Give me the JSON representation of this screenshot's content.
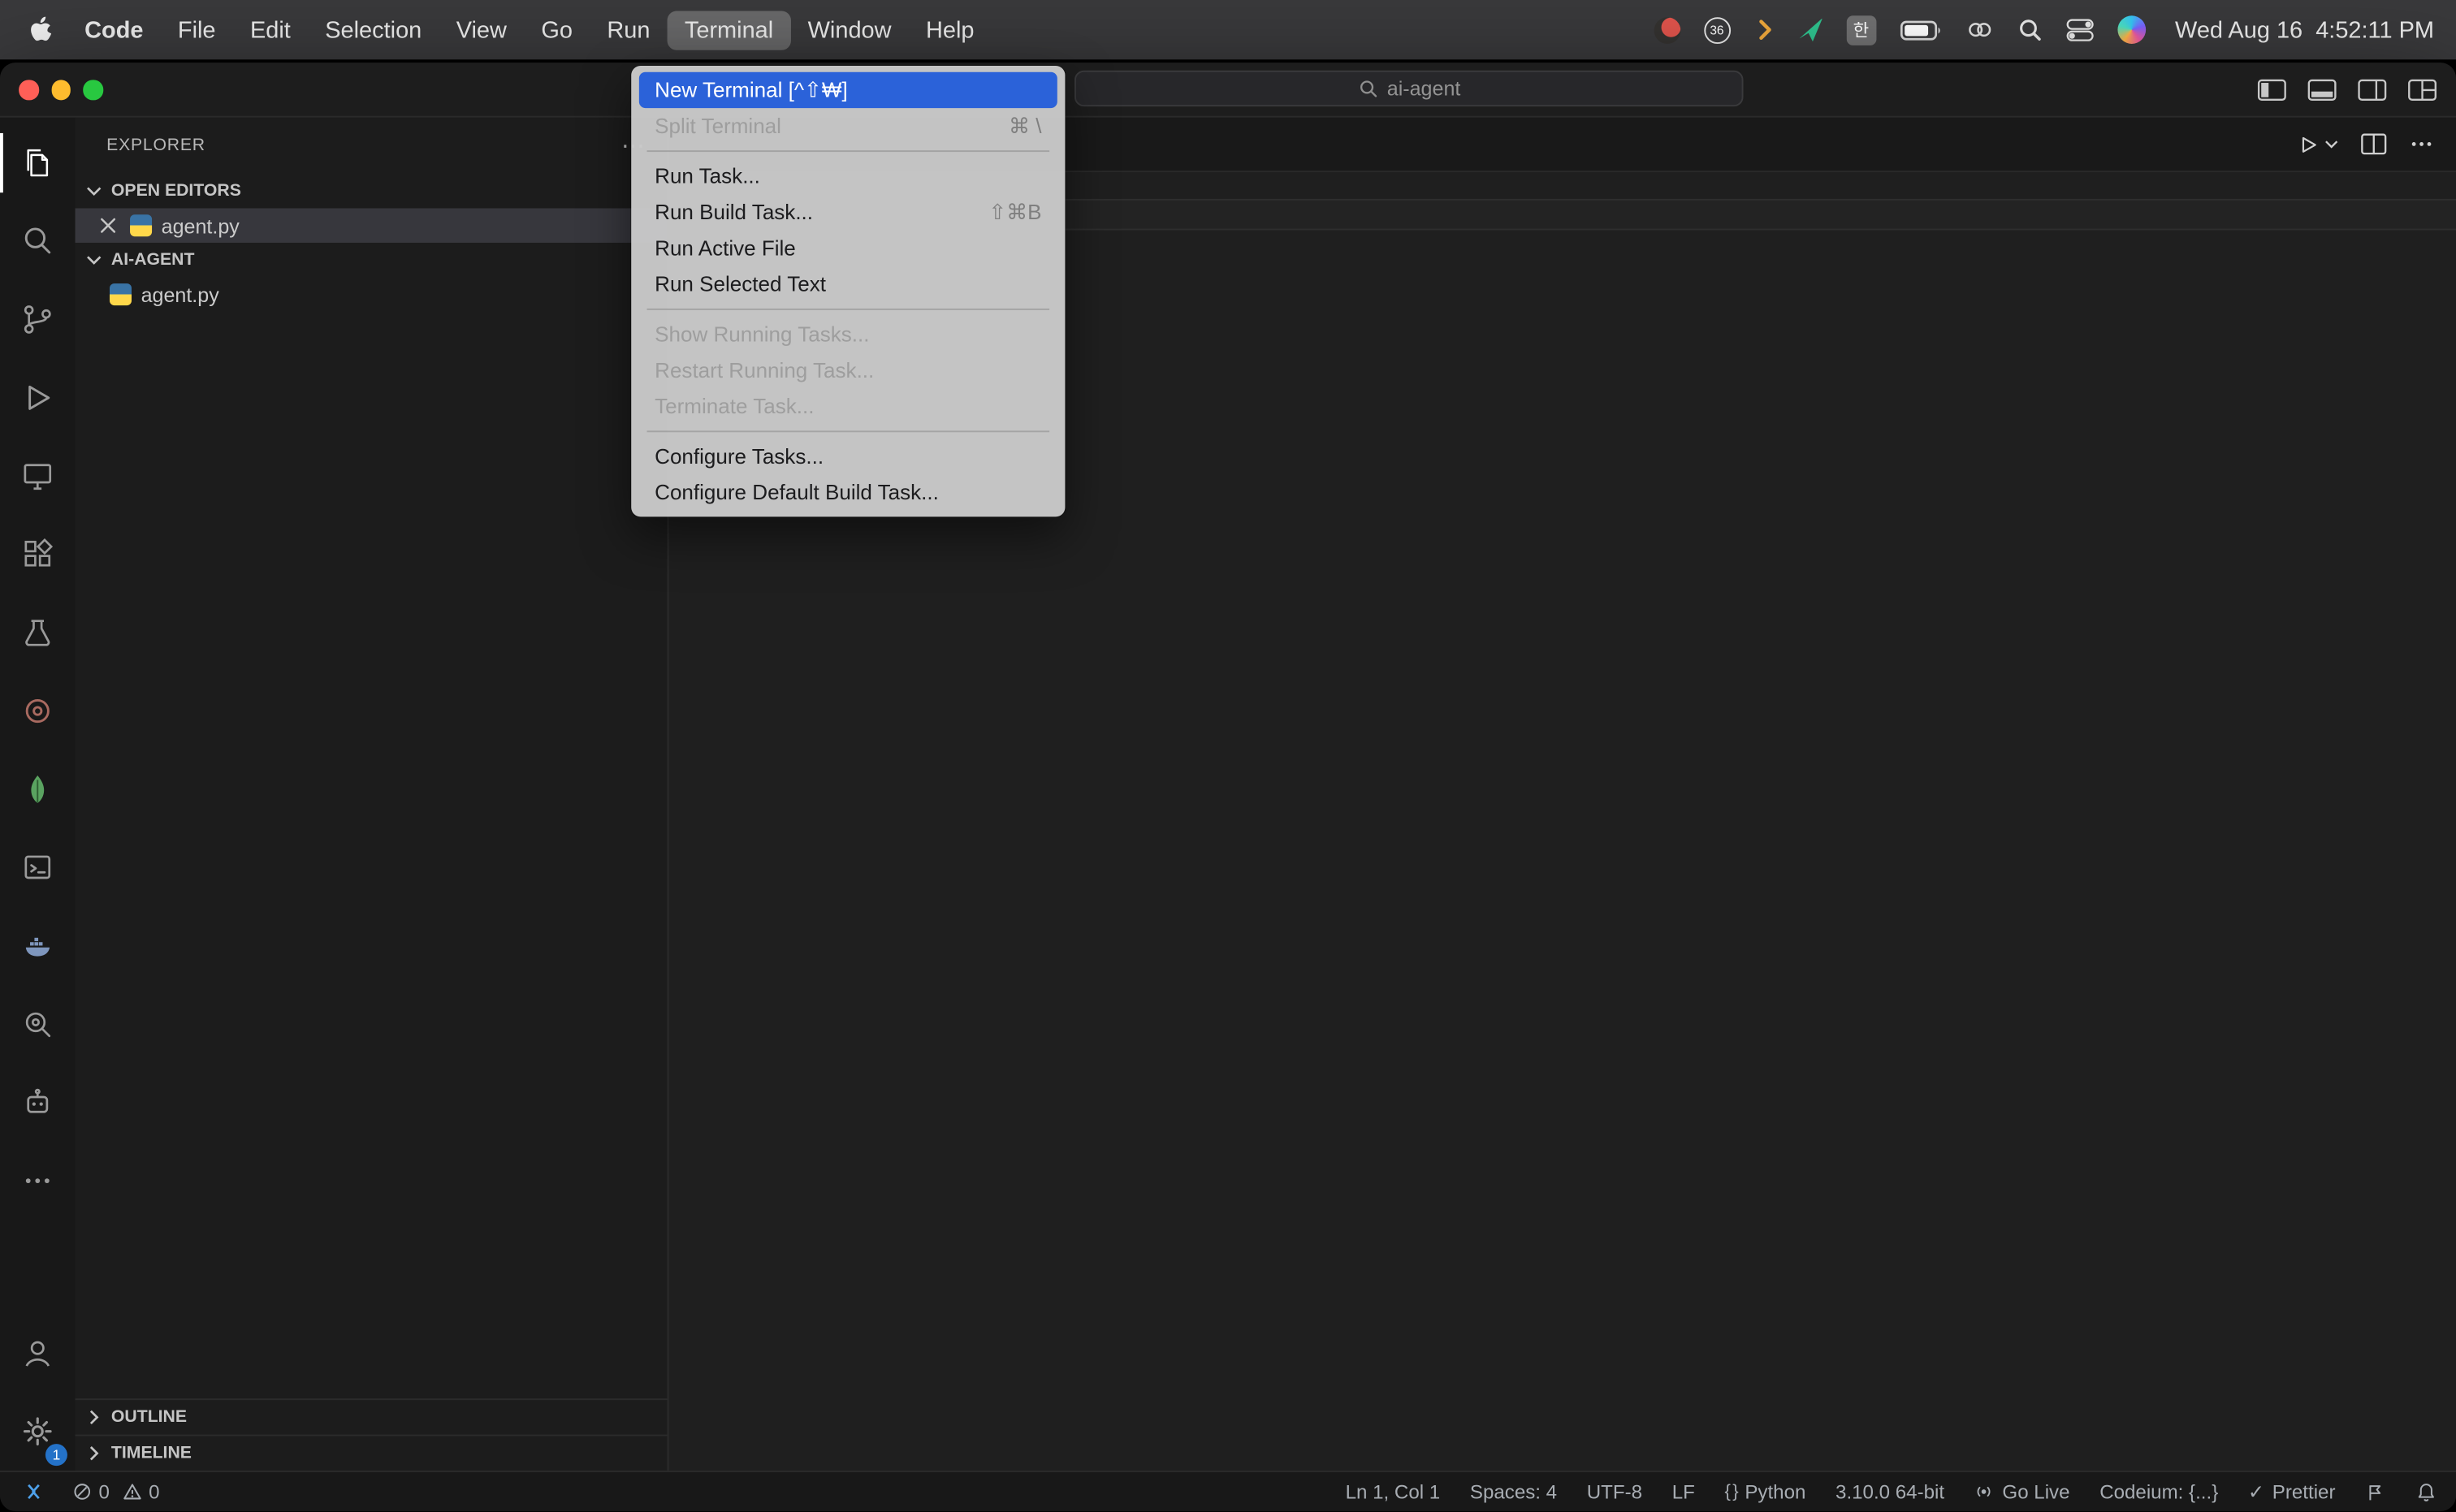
{
  "colors": {
    "menu_highlight": "#2B62D9",
    "selection_row": "#37373D",
    "settings_badge_blue": "#2472C8",
    "traffic_red": "#FF5F57",
    "traffic_yellow": "#FEBC2E",
    "traffic_green": "#28C840"
  },
  "menubar": {
    "app_name": "Code",
    "menus": [
      {
        "label": "File"
      },
      {
        "label": "Edit"
      },
      {
        "label": "Selection"
      },
      {
        "label": "View"
      },
      {
        "label": "Go"
      },
      {
        "label": "Run"
      },
      {
        "label": "Terminal",
        "active": true
      },
      {
        "label": "Window"
      },
      {
        "label": "Help"
      }
    ],
    "status_icon_names": [
      "app-status-icon",
      "cpu-meter-icon",
      "shell-chevron-icon",
      "green-app-icon",
      "input-source-indicator",
      "battery-icon",
      "link-icon",
      "spotlight-search-icon",
      "control-center-icon",
      "siri-icon"
    ],
    "cpu_badge": "36",
    "input_source": "한",
    "clock": "Wed Aug 16  4:52:11 PM"
  },
  "titlebar": {
    "search_value": "ai-agent",
    "layout_control_names": [
      "toggle-primary-sidebar-icon",
      "toggle-panel-icon",
      "toggle-secondary-sidebar-icon",
      "customize-layout-icon"
    ]
  },
  "terminal_menu": {
    "items": [
      {
        "label": "New Terminal [^⇧₩]",
        "selected": true
      },
      {
        "label": "Split Terminal",
        "shortcut": "⌘ \\",
        "disabled": true,
        "separator_after": true
      },
      {
        "label": "Run Task..."
      },
      {
        "label": "Run Build Task...",
        "shortcut": "⇧⌘B"
      },
      {
        "label": "Run Active File"
      },
      {
        "label": "Run Selected Text",
        "separator_after": true
      },
      {
        "label": "Show Running Tasks...",
        "disabled": true
      },
      {
        "label": "Restart Running Task...",
        "disabled": true
      },
      {
        "label": "Terminate Task...",
        "disabled": true,
        "separator_after": true
      },
      {
        "label": "Configure Tasks..."
      },
      {
        "label": "Configure Default Build Task..."
      }
    ]
  },
  "activity_bar": {
    "icon_names": [
      "explorer-icon",
      "search-icon",
      "source-control-icon",
      "run-and-debug-icon",
      "remote-explorer-icon",
      "extensions-icon",
      "testing-icon",
      "ring-extension-icon",
      "mongodb-icon",
      "remote-terminal-icon",
      "docker-icon",
      "code-search-icon",
      "ai-assistant-icon",
      "more-icon"
    ],
    "bottom_icon_names": [
      "accounts-icon",
      "settings-gear-icon"
    ],
    "settings_badge": "1"
  },
  "explorer": {
    "title": "EXPLORER",
    "open_editors_label": "OPEN EDITORS",
    "open_editor_file": "agent.py",
    "folder_label": "AI-AGENT",
    "folder_file": "agent.py",
    "outline_label": "OUTLINE",
    "timeline_label": "TIMELINE"
  },
  "editor": {
    "action_names": [
      "run-python-file-icon",
      "run-dropdown-icon",
      "split-editor-icon",
      "more-actions-icon"
    ],
    "cursor_line": "1"
  },
  "statusbar": {
    "errors": "0",
    "warnings": "0",
    "cursor_position": "Ln 1, Col 1",
    "indentation": "Spaces: 4",
    "encoding": "UTF-8",
    "eol": "LF",
    "language_prefix": "{ }",
    "language": "Python",
    "interpreter": "3.10.0 64-bit",
    "go_live": "Go Live",
    "codeium": "Codeium: {...}",
    "prettier_check": "✓",
    "prettier": "Prettier"
  }
}
